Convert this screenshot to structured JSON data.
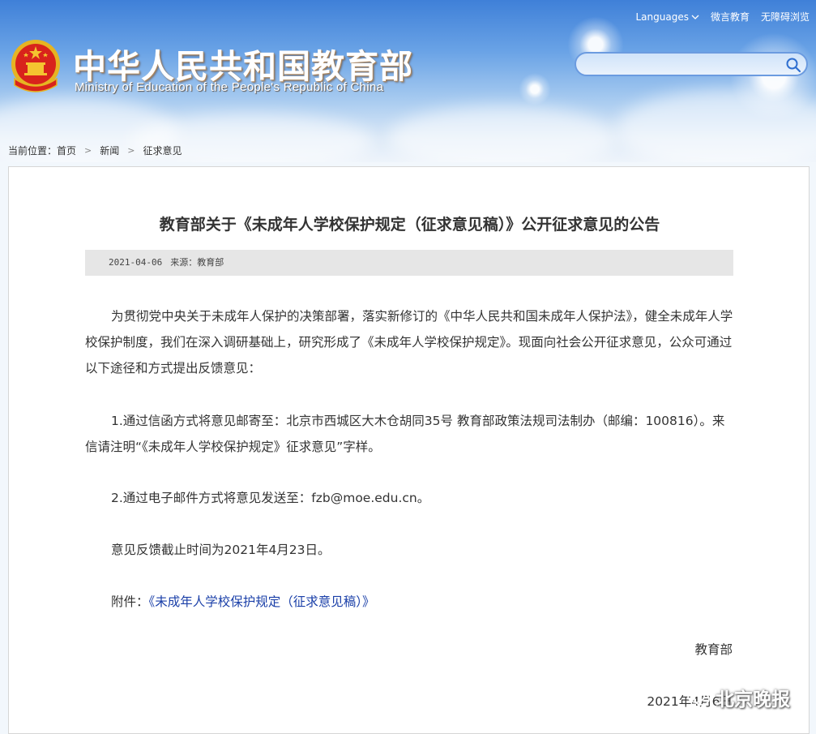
{
  "header": {
    "title_cn": "中华人民共和国教育部",
    "title_en": "Ministry of Education of the People's Republic of China",
    "top_links": {
      "languages": "Languages",
      "weiyan": "微言教育",
      "accessible": "无障碍浏览"
    },
    "search": {
      "placeholder": "",
      "value": ""
    }
  },
  "breadcrumb": {
    "prefix": "当前位置：",
    "items": [
      "首页",
      "新闻",
      "征求意见"
    ]
  },
  "article": {
    "title": "教育部关于《未成年人学校保护规定（征求意见稿）》公开征求意见的公告",
    "date": "2021-04-06",
    "source": "来源：教育部",
    "paragraphs": [
      "为贯彻党中央关于未成年人保护的决策部署，落实新修订的《中华人民共和国未成年人保护法》，健全未成年人学校保护制度，我们在深入调研基础上，研究形成了《未成年人学校保护规定》。现面向社会公开征求意见，公众可通过以下途径和方式提出反馈意见：",
      "1.通过信函方式将意见邮寄至：北京市西城区大木仓胡同35号 教育部政策法规司法制办（邮编：100816）。来信请注明“《未成年人学校保护规定》征求意见”字样。",
      "2.通过电子邮件方式将意见发送至：fzb@moe.edu.cn。",
      "意见反馈截止时间为2021年4月23日。"
    ],
    "attachment_label": "附件：",
    "attachment_link": "《未成年人学校保护规定（征求意见稿）》",
    "signature": "教育部",
    "sign_date": "2021年4月6日"
  },
  "watermark": "北京晚报",
  "colors": {
    "link": "#1a3fa8",
    "header_blue": "#3f80d8",
    "emblem_red": "#d8231c",
    "emblem_gold": "#f4c430"
  }
}
